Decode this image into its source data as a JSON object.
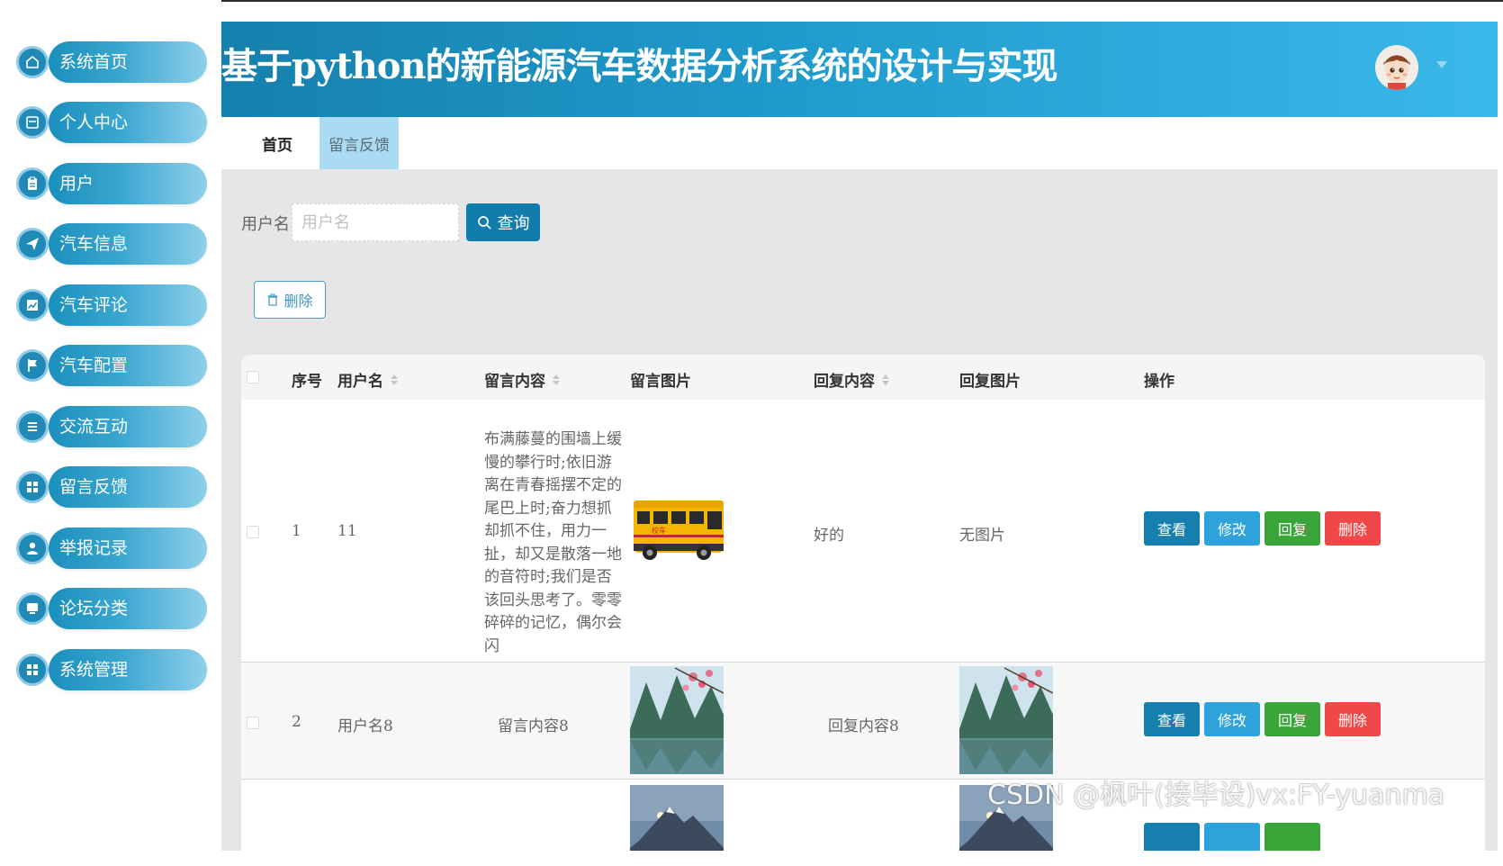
{
  "header": {
    "title": "基于python的新能源汽车数据分析系统的设计与实现",
    "accent": "#1f9bcc"
  },
  "sidebar": {
    "items": [
      {
        "label": "系统首页",
        "icon": "home-icon"
      },
      {
        "label": "个人中心",
        "icon": "profile-card-icon"
      },
      {
        "label": "用户",
        "icon": "clipboard-icon"
      },
      {
        "label": "汽车信息",
        "icon": "paper-plane-icon"
      },
      {
        "label": "汽车评论",
        "icon": "line-chart-icon"
      },
      {
        "label": "汽车配置",
        "icon": "flag-icon"
      },
      {
        "label": "交流互动",
        "icon": "list-icon"
      },
      {
        "label": "留言反馈",
        "icon": "grid-icon"
      },
      {
        "label": "举报记录",
        "icon": "user-icon"
      },
      {
        "label": "论坛分类",
        "icon": "monitor-icon"
      },
      {
        "label": "系统管理",
        "icon": "grid-icon"
      }
    ]
  },
  "tabs": [
    {
      "label": "首页"
    },
    {
      "label": "留言反馈"
    }
  ],
  "search": {
    "label": "用户名",
    "placeholder": "用户名",
    "button": "查询"
  },
  "toolbar": {
    "delete_label": "删除"
  },
  "table": {
    "columns": {
      "index": "序号",
      "username": "用户名",
      "message": "留言内容",
      "message_image": "留言图片",
      "reply": "回复内容",
      "reply_image": "回复图片",
      "actions": "操作"
    },
    "rows": [
      {
        "index": "1",
        "username": "11",
        "message": "布满藤蔓的围墙上缓慢的攀行时;依旧游离在青春摇摆不定的尾巴上时;奋力想抓却抓不住，用力一扯，却又是散落一地的音符时;我们是否该回头思考了。零零碎碎的记忆，偶尔会闪",
        "message_image": "school-bus-image",
        "reply": "好的",
        "reply_image_text": "无图片"
      },
      {
        "index": "2",
        "username": "用户名8",
        "message": "留言内容8",
        "message_image": "mountain-lake-image",
        "reply": "回复内容8",
        "reply_image": "mountain-lake-image"
      }
    ],
    "actions": {
      "view": "查看",
      "edit": "修改",
      "reply": "回复",
      "delete": "删除"
    }
  },
  "watermark": "CSDN @枫叶(接毕设)vx:FY-yuanma"
}
